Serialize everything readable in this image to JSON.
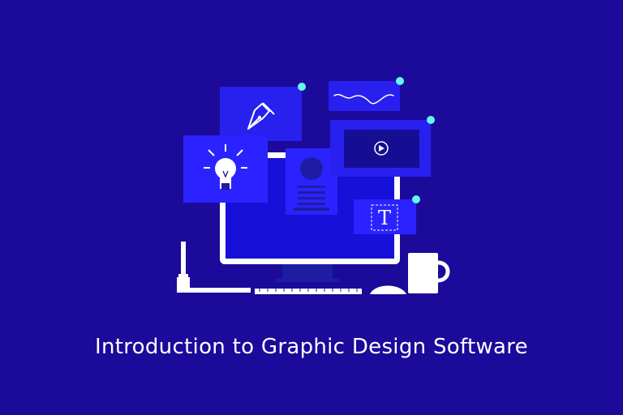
{
  "headline": {
    "text": "Introduction to Graphic Design Software"
  },
  "text_tool_glyph": "T",
  "colors": {
    "background": "#1c0a9b",
    "panel_blue": "#2720ef",
    "panel_blue_alt": "#2b23ff",
    "monitor_screen": "#1710d8",
    "monitor_frame": "#ffffff",
    "video_screen": "#160e92",
    "accent_dot": "#66f4ec",
    "dark_ink": "#1f1ca4"
  },
  "icons": [
    "pen-tool-icon",
    "lightbulb-icon",
    "waveform-icon",
    "play-icon",
    "text-tool-icon",
    "stylus-icon",
    "keyboard-icon",
    "mouse-icon",
    "mug-icon",
    "monitor-icon"
  ]
}
